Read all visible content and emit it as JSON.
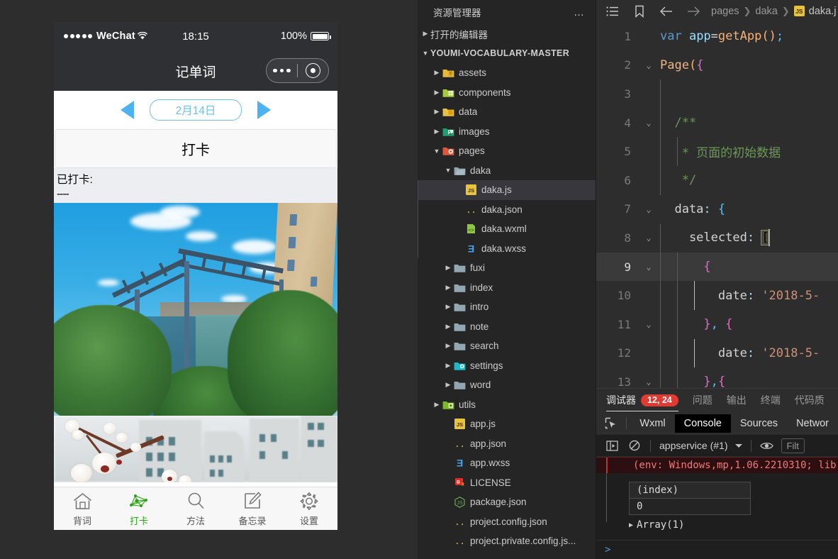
{
  "simulator": {
    "status_bar": {
      "carrier": "WeChat",
      "time": "18:15",
      "battery": "100%"
    },
    "nav": {
      "title": "记单词"
    },
    "date_nav": {
      "prev_icon": "triangle-left-icon",
      "next_icon": "triangle-right-icon",
      "date": "2月14日"
    },
    "checkin_button": "打卡",
    "done_label": "已打卡:",
    "done_dashes": "----",
    "tabbar": [
      {
        "label": "背词",
        "icon": "home-icon",
        "active": false
      },
      {
        "label": "打卡",
        "icon": "network-icon",
        "active": true
      },
      {
        "label": "方法",
        "icon": "search-icon",
        "active": false
      },
      {
        "label": "备忘录",
        "icon": "note-edit-icon",
        "active": false
      },
      {
        "label": "设置",
        "icon": "gear-icon",
        "active": false
      }
    ]
  },
  "explorer": {
    "title": "资源管理器",
    "more_icon": "ellipsis-icon",
    "open_editors": "打开的编辑器",
    "project": "YOUMI-VOCABULARY-MASTER",
    "items": [
      {
        "label": "assets",
        "type": "folder",
        "icon": "folder-assets-icon",
        "depth": 1,
        "twisty": "right"
      },
      {
        "label": "components",
        "type": "folder",
        "icon": "folder-components-icon",
        "depth": 1,
        "twisty": "right"
      },
      {
        "label": "data",
        "type": "folder",
        "icon": "folder-data-icon",
        "depth": 1,
        "twisty": "right"
      },
      {
        "label": "images",
        "type": "folder",
        "icon": "folder-images-icon",
        "depth": 1,
        "twisty": "right"
      },
      {
        "label": "pages",
        "type": "folder",
        "icon": "folder-pages-icon",
        "depth": 1,
        "twisty": "down"
      },
      {
        "label": "daka",
        "type": "folder",
        "icon": "folder-open-icon",
        "depth": 2,
        "twisty": "down"
      },
      {
        "label": "daka.js",
        "type": "file",
        "icon": "js-icon",
        "depth": 3,
        "twisty": "none",
        "selected": true
      },
      {
        "label": "daka.json",
        "type": "file",
        "icon": "json-icon",
        "depth": 3,
        "twisty": "none"
      },
      {
        "label": "daka.wxml",
        "type": "file",
        "icon": "wxml-icon",
        "depth": 3,
        "twisty": "none"
      },
      {
        "label": "daka.wxss",
        "type": "file",
        "icon": "css-icon",
        "depth": 3,
        "twisty": "none"
      },
      {
        "label": "fuxi",
        "type": "folder",
        "icon": "folder-icon",
        "depth": 2,
        "twisty": "right"
      },
      {
        "label": "index",
        "type": "folder",
        "icon": "folder-icon",
        "depth": 2,
        "twisty": "right"
      },
      {
        "label": "intro",
        "type": "folder",
        "icon": "folder-icon",
        "depth": 2,
        "twisty": "right"
      },
      {
        "label": "note",
        "type": "folder",
        "icon": "folder-icon",
        "depth": 2,
        "twisty": "right"
      },
      {
        "label": "search",
        "type": "folder",
        "icon": "folder-icon",
        "depth": 2,
        "twisty": "right"
      },
      {
        "label": "settings",
        "type": "folder",
        "icon": "folder-settings-icon",
        "depth": 2,
        "twisty": "right"
      },
      {
        "label": "word",
        "type": "folder",
        "icon": "folder-icon",
        "depth": 2,
        "twisty": "right"
      },
      {
        "label": "utils",
        "type": "folder",
        "icon": "folder-utils-icon",
        "depth": 1,
        "twisty": "right"
      },
      {
        "label": "app.js",
        "type": "file",
        "icon": "js-icon",
        "depth": 2,
        "twisty": "none"
      },
      {
        "label": "app.json",
        "type": "file",
        "icon": "json-icon",
        "depth": 2,
        "twisty": "none"
      },
      {
        "label": "app.wxss",
        "type": "file",
        "icon": "css-icon",
        "depth": 2,
        "twisty": "none"
      },
      {
        "label": "LICENSE",
        "type": "file",
        "icon": "license-icon",
        "depth": 2,
        "twisty": "none"
      },
      {
        "label": "package.json",
        "type": "file",
        "icon": "npm-icon",
        "depth": 2,
        "twisty": "none"
      },
      {
        "label": "project.config.json",
        "type": "file",
        "icon": "json-icon",
        "depth": 2,
        "twisty": "none"
      },
      {
        "label": "project.private.config.js...",
        "type": "file",
        "icon": "json-icon",
        "depth": 2,
        "twisty": "none"
      }
    ]
  },
  "editor": {
    "toolbar": {
      "outline_icon": "list-icon",
      "bookmark_icon": "bookmark-icon",
      "back_icon": "arrow-left-icon",
      "forward_icon": "arrow-right-icon"
    },
    "breadcrumb": [
      "pages",
      "daka",
      "daka.j"
    ],
    "breadcrumb_file_badge": "JS",
    "lines": [
      {
        "n": "1",
        "fold": "",
        "indent": 0,
        "hl": false,
        "tokens": [
          {
            "t": "var ",
            "c": "kw2"
          },
          {
            "t": "app",
            "c": "var"
          },
          {
            "t": "=",
            "c": "pun"
          },
          {
            "t": "getApp",
            "c": "pl"
          },
          {
            "t": "(",
            "c": "pl"
          },
          {
            "t": ")",
            "c": "pl"
          },
          {
            "t": ";",
            "c": "p3c"
          }
        ]
      },
      {
        "n": "2",
        "fold": "v",
        "indent": 0,
        "hl": false,
        "tokens": [
          {
            "t": "Page",
            "c": "pl"
          },
          {
            "t": "(",
            "c": "pl"
          },
          {
            "t": "{",
            "c": "p2c"
          }
        ]
      },
      {
        "n": "3",
        "fold": "",
        "indent": 1,
        "hl": false,
        "tokens": []
      },
      {
        "n": "4",
        "fold": "v",
        "indent": 1,
        "hl": false,
        "tokens": [
          {
            "t": "  /**",
            "c": "cm"
          }
        ]
      },
      {
        "n": "5",
        "fold": "",
        "indent": 2,
        "hl": false,
        "tokens": [
          {
            "t": "   * 页面的初始数据",
            "c": "cm"
          }
        ]
      },
      {
        "n": "6",
        "fold": "",
        "indent": 1,
        "hl": false,
        "tokens": [
          {
            "t": "   */",
            "c": "cm"
          }
        ]
      },
      {
        "n": "7",
        "fold": "v",
        "indent": 0,
        "hl": false,
        "tokens": [
          {
            "t": "  data",
            "c": "pun"
          },
          {
            "t": ": ",
            "c": "var"
          },
          {
            "t": "{",
            "c": "p3c"
          }
        ]
      },
      {
        "n": "8",
        "fold": "v",
        "indent": 1,
        "hl": false,
        "tokens": [
          {
            "t": "    selected",
            "c": "pun"
          },
          {
            "t": ": ",
            "c": "var"
          },
          {
            "t": "[",
            "c": "brk"
          }
        ]
      },
      {
        "n": "9",
        "fold": "v",
        "indent": 2,
        "hl": true,
        "tokens": [
          {
            "t": "      {",
            "c": "p2c"
          }
        ]
      },
      {
        "n": "10",
        "fold": "",
        "indent": 3,
        "hl": false,
        "tokens": [
          {
            "t": "        date",
            "c": "pun"
          },
          {
            "t": ": ",
            "c": "var"
          },
          {
            "t": "'2018-5-",
            "c": "str"
          }
        ]
      },
      {
        "n": "11",
        "fold": "v",
        "indent": 2,
        "hl": false,
        "tokens": [
          {
            "t": "      }",
            "c": "p2c"
          },
          {
            "t": ", ",
            "c": "p3c"
          },
          {
            "t": "{",
            "c": "p2c"
          }
        ]
      },
      {
        "n": "12",
        "fold": "",
        "indent": 3,
        "hl": false,
        "tokens": [
          {
            "t": "        date",
            "c": "pun"
          },
          {
            "t": ": ",
            "c": "var"
          },
          {
            "t": "'2018-5-",
            "c": "str"
          }
        ]
      },
      {
        "n": "13",
        "fold": "v",
        "indent": 2,
        "hl": false,
        "tokens": [
          {
            "t": "      }",
            "c": "p2c"
          },
          {
            "t": ",",
            "c": "p3c"
          },
          {
            "t": "{",
            "c": "p2c"
          }
        ]
      }
    ]
  },
  "debug": {
    "panel_tabs": [
      {
        "label": "调试器",
        "badge": "12, 24",
        "active": true
      },
      {
        "label": "问题",
        "badge": "",
        "active": false
      },
      {
        "label": "输出",
        "badge": "",
        "active": false
      },
      {
        "label": "终端",
        "badge": "",
        "active": false
      },
      {
        "label": "代码质",
        "badge": "",
        "active": false
      }
    ],
    "devtools_tabs": [
      {
        "label": "Wxml",
        "active": false
      },
      {
        "label": "Console",
        "active": true
      },
      {
        "label": "Sources",
        "active": false
      },
      {
        "label": "Networ",
        "active": false
      }
    ],
    "inspect_icon": "cursor-select-icon",
    "console_toolbar": {
      "sidebar_icon": "console-sidebar-icon",
      "clear_icon": "clear-console-icon",
      "context": "appservice (#1)",
      "eye_icon": "eye-icon",
      "filter_placeholder": "Filt"
    },
    "error_message": "(env: Windows,mp,1.06.2210310; lib:",
    "table": {
      "header": "(index)",
      "rows": [
        "0"
      ]
    },
    "array_entry": "Array(1)",
    "prompt_symbol": ">"
  }
}
